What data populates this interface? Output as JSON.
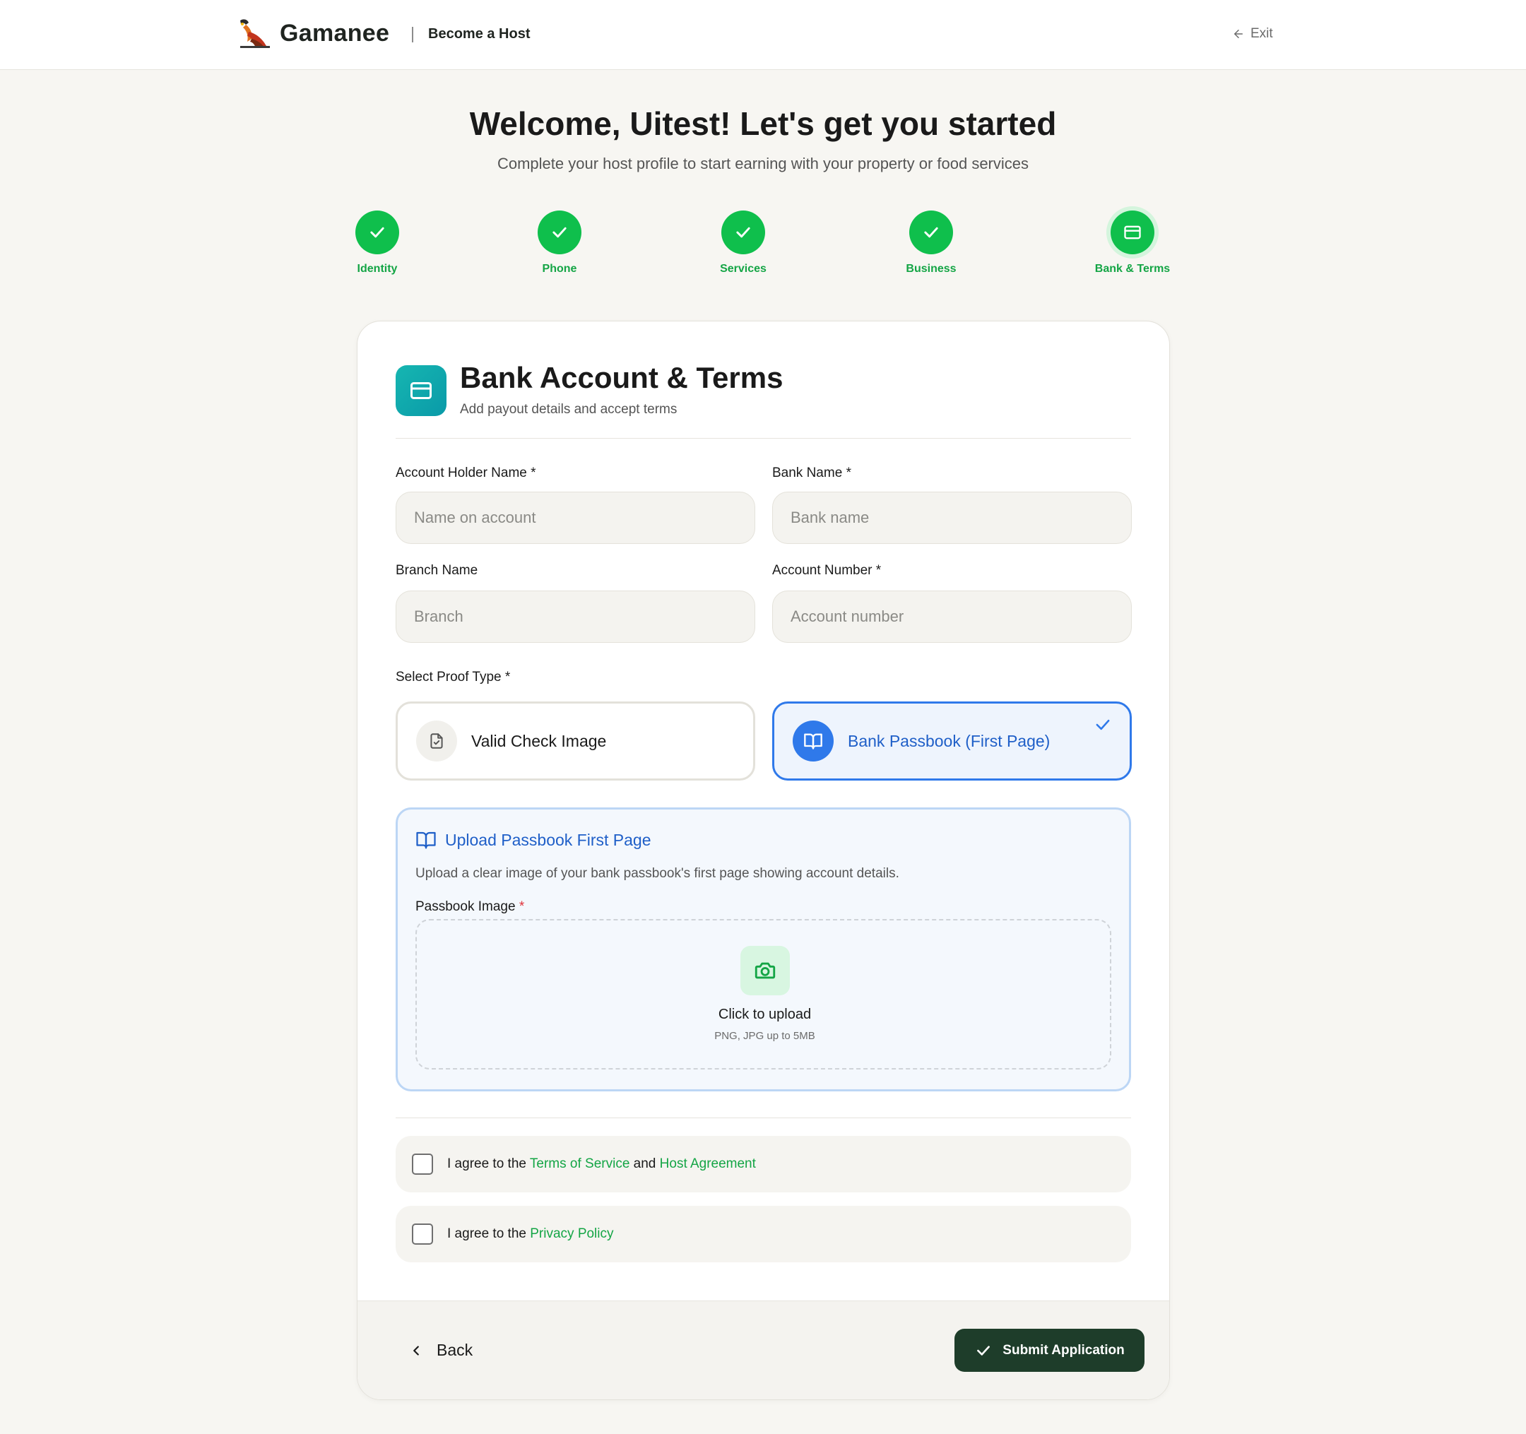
{
  "header": {
    "brand": "Gamanee",
    "subtitle": "Become a Host",
    "exit_label": "Exit"
  },
  "welcome": {
    "title": "Welcome, Uitest! Let's get you started",
    "subtitle": "Complete your host profile to start earning with your property or food services"
  },
  "steps": [
    {
      "label": "Identity",
      "status": "complete",
      "icon": "check-icon"
    },
    {
      "label": "Phone",
      "status": "complete",
      "icon": "check-icon"
    },
    {
      "label": "Services",
      "status": "complete",
      "icon": "check-icon"
    },
    {
      "label": "Business",
      "status": "complete",
      "icon": "check-icon"
    },
    {
      "label": "Bank & Terms",
      "status": "current",
      "icon": "credit-card-icon"
    }
  ],
  "card": {
    "title": "Bank Account & Terms",
    "subtitle": "Add payout details and accept terms",
    "icon": "credit-card-icon"
  },
  "form": {
    "account_holder": {
      "label": "Account Holder Name",
      "required": "*",
      "placeholder": "Name on account",
      "value": ""
    },
    "bank_name": {
      "label": "Bank Name",
      "required": "*",
      "placeholder": "Bank name",
      "value": ""
    },
    "branch_name": {
      "label": "Branch Name",
      "placeholder": "Branch",
      "value": ""
    },
    "account_number": {
      "label": "Account Number",
      "required": "*",
      "placeholder": "Account number",
      "value": ""
    }
  },
  "proof": {
    "label": "Select Proof Type",
    "required": "*",
    "options": [
      {
        "label": "Valid Check Image",
        "icon": "file-check-icon",
        "selected": false
      },
      {
        "label": "Bank Passbook (First Page)",
        "icon": "book-open-icon",
        "selected": true
      }
    ]
  },
  "upload": {
    "title": "Upload Passbook First Page",
    "description": "Upload a clear image of your bank passbook's first page showing account details.",
    "field_label": "Passbook Image",
    "required": "*",
    "dropzone_title": "Click to upload",
    "dropzone_sub": "PNG, JPG up to 5MB",
    "icon": "camera-icon"
  },
  "agreements": {
    "terms": {
      "prefix": "I agree to the ",
      "link1": "Terms of Service",
      "middle": " and ",
      "link2": "Host Agreement",
      "checked": false
    },
    "privacy": {
      "prefix": "I agree to the ",
      "link1": "Privacy Policy",
      "checked": false
    }
  },
  "footer": {
    "back_label": "Back",
    "submit_label": "Submit Application"
  },
  "colors": {
    "accent_green": "#0fbf4c",
    "link_green": "#14a545",
    "selected_blue": "#2f79ea",
    "submit_bg": "#1e3d2a",
    "teal_icon": "#16b6b1"
  }
}
